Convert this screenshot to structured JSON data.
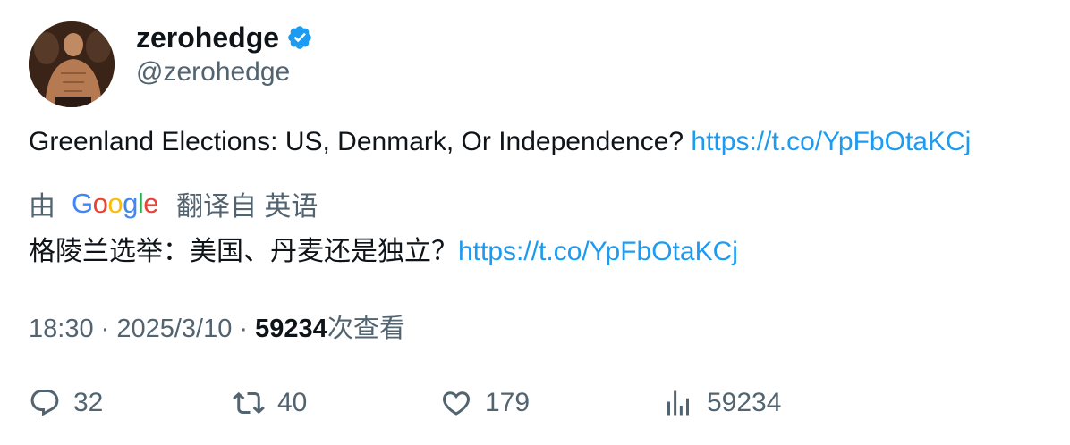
{
  "author": {
    "display_name": "zerohedge",
    "handle": "@zerohedge",
    "verified": true,
    "verified_color": "#1d9bf0"
  },
  "tweet": {
    "text": "Greenland Elections: US, Denmark, Or Independence? ",
    "link": "https://t.co/YpFbOtaKCj"
  },
  "translation": {
    "by_label": "由",
    "provider": "Google",
    "source_label": "翻译自 英语",
    "text": "格陵兰选举：美国、丹麦还是独立？",
    "link": "https://t.co/YpFbOtaKCj"
  },
  "meta": {
    "time": "18:30",
    "separator": " · ",
    "date": "2025/3/10",
    "views_count": "59234",
    "views_label": "次查看"
  },
  "actions": {
    "replies": "32",
    "retweets": "40",
    "likes": "179",
    "views": "59234"
  },
  "colors": {
    "link": "#1d9bf0",
    "secondary_text": "#536471",
    "primary_text": "#0f1419"
  }
}
